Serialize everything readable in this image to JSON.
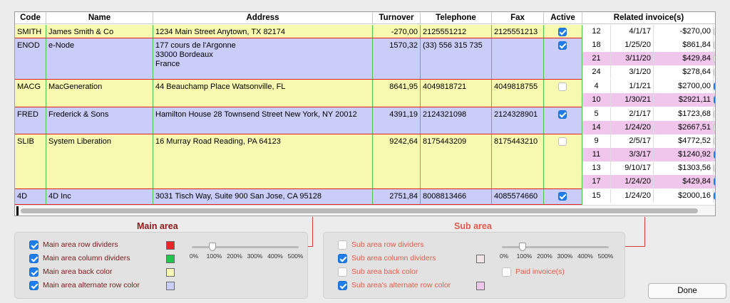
{
  "columns": {
    "code": "Code",
    "name": "Name",
    "address": "Address",
    "turnover": "Turnover",
    "telephone": "Telephone",
    "fax": "Fax",
    "active": "Active",
    "related": "Related invoice(s)"
  },
  "colors": {
    "row_yellow": "#f8f9b0",
    "row_blue": "#cacdf7",
    "row_divider": "#e02020",
    "col_divider": "#4cc84c",
    "sub_white": "#ffffff",
    "sub_pink": "#f1c6ec"
  },
  "rows": [
    {
      "code": "SMITH",
      "name": "James Smith & Co",
      "address": "1234 Main Street Anytown, TX 82174",
      "turnover": "-270,00",
      "telephone": "2125551212",
      "fax": "2125551213",
      "active": true,
      "invoices": [
        {
          "num": "12",
          "date": "4/1/17",
          "amount": "-$270,00",
          "paid": false
        }
      ]
    },
    {
      "code": "ENOD",
      "name": "e-Node",
      "address": "177 cours de l'Argonne\n33000 Bordeaux\nFrance",
      "turnover": "1570,32",
      "telephone": "(33) 556 315 735",
      "fax": "",
      "active": true,
      "invoices": [
        {
          "num": "18",
          "date": "1/25/20",
          "amount": "$861,84",
          "paid": false
        },
        {
          "num": "21",
          "date": "3/11/20",
          "amount": "$429,84",
          "paid": false
        },
        {
          "num": "24",
          "date": "3/1/20",
          "amount": "$278,64",
          "paid": false
        }
      ]
    },
    {
      "code": "MACG",
      "name": "MacGeneration",
      "address": "44 Beauchamp Place Watsonville, FL",
      "turnover": "8641,95",
      "telephone": "4049818721",
      "fax": "4049818755",
      "active": false,
      "invoices": [
        {
          "num": "4",
          "date": "1/1/21",
          "amount": "$2700,00",
          "paid": true
        },
        {
          "num": "10",
          "date": "1/30/21",
          "amount": "$2921,11",
          "paid": true
        }
      ]
    },
    {
      "code": "FRED",
      "name": "Frederick & Sons",
      "address": "Hamilton House 28 Townsend Street New York, NY 20012",
      "turnover": "4391,19",
      "telephone": "2124321098",
      "fax": "2124328901",
      "active": true,
      "invoices": [
        {
          "num": "5",
          "date": "2/1/17",
          "amount": "$1723,68",
          "paid": false
        },
        {
          "num": "14",
          "date": "1/24/20",
          "amount": "$2667,51",
          "paid": false
        }
      ]
    },
    {
      "code": "SLIB",
      "name": "System Liberation",
      "address": "16 Murray Road Reading, PA 64123",
      "turnover": "9242,64",
      "telephone": "8175443209",
      "fax": "8175443210",
      "active": false,
      "invoices": [
        {
          "num": "9",
          "date": "2/5/17",
          "amount": "$4772,52",
          "paid": false
        },
        {
          "num": "11",
          "date": "3/3/17",
          "amount": "$1240,92",
          "paid": true
        },
        {
          "num": "13",
          "date": "9/10/17",
          "amount": "$1303,56",
          "paid": false
        },
        {
          "num": "17",
          "date": "1/24/20",
          "amount": "$429,84",
          "paid": true
        }
      ]
    },
    {
      "code": "4D",
      "name": "4D Inc",
      "address": "3031 Tisch Way, Suite 900 San Jose, CA 95128",
      "turnover": "2751,84",
      "telephone": "8008813466",
      "fax": "4085574660",
      "active": true,
      "invoices": [
        {
          "num": "15",
          "date": "1/24/20",
          "amount": "$2000,16",
          "paid": true
        }
      ]
    }
  ],
  "main_area": {
    "title": "Main area",
    "options": [
      {
        "label": "Main area row dividers",
        "checked": true,
        "swatch": "#e8262a"
      },
      {
        "label": "Main area column dividers",
        "checked": true,
        "swatch": "#22c44a"
      },
      {
        "label": "Main area back color",
        "checked": true,
        "swatch": "#f8f9b0"
      },
      {
        "label": "Main area alternate row color",
        "checked": true,
        "swatch": "#cacdf7"
      }
    ],
    "slider": {
      "value_percent": 100,
      "ticks": [
        "0%",
        "100%",
        "200%",
        "300%",
        "400%",
        "500%"
      ]
    }
  },
  "sub_area": {
    "title": "Sub area",
    "options": [
      {
        "label": "Sub area row dividers",
        "checked": false
      },
      {
        "label": "Sub area column dividers",
        "checked": true,
        "swatch": "#f1e4e4"
      },
      {
        "label": "Sub area back color",
        "checked": false
      },
      {
        "label": "Sub area's alternate row color",
        "checked": true,
        "swatch": "#f1c6ec"
      }
    ],
    "paid_label": "Paid invoice(s)",
    "paid_checked": false,
    "slider": {
      "value_percent": 100,
      "ticks": [
        "0%",
        "100%",
        "200%",
        "300%",
        "400%",
        "500%"
      ]
    }
  },
  "done_label": "Done"
}
